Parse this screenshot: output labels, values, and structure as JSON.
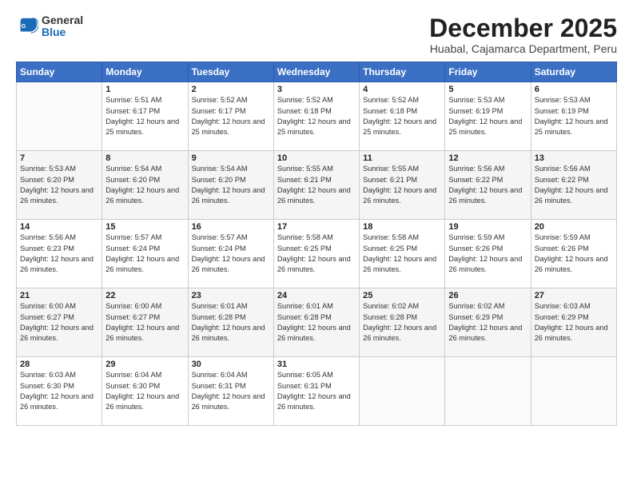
{
  "logo": {
    "general": "General",
    "blue": "Blue"
  },
  "title": "December 2025",
  "subtitle": "Huabal, Cajamarca Department, Peru",
  "days_of_week": [
    "Sunday",
    "Monday",
    "Tuesday",
    "Wednesday",
    "Thursday",
    "Friday",
    "Saturday"
  ],
  "weeks": [
    [
      {
        "day": "",
        "sunrise": "",
        "sunset": "",
        "daylight": ""
      },
      {
        "day": "1",
        "sunrise": "Sunrise: 5:51 AM",
        "sunset": "Sunset: 6:17 PM",
        "daylight": "Daylight: 12 hours and 25 minutes."
      },
      {
        "day": "2",
        "sunrise": "Sunrise: 5:52 AM",
        "sunset": "Sunset: 6:17 PM",
        "daylight": "Daylight: 12 hours and 25 minutes."
      },
      {
        "day": "3",
        "sunrise": "Sunrise: 5:52 AM",
        "sunset": "Sunset: 6:18 PM",
        "daylight": "Daylight: 12 hours and 25 minutes."
      },
      {
        "day": "4",
        "sunrise": "Sunrise: 5:52 AM",
        "sunset": "Sunset: 6:18 PM",
        "daylight": "Daylight: 12 hours and 25 minutes."
      },
      {
        "day": "5",
        "sunrise": "Sunrise: 5:53 AM",
        "sunset": "Sunset: 6:19 PM",
        "daylight": "Daylight: 12 hours and 25 minutes."
      },
      {
        "day": "6",
        "sunrise": "Sunrise: 5:53 AM",
        "sunset": "Sunset: 6:19 PM",
        "daylight": "Daylight: 12 hours and 25 minutes."
      }
    ],
    [
      {
        "day": "7",
        "sunrise": "Sunrise: 5:53 AM",
        "sunset": "Sunset: 6:20 PM",
        "daylight": "Daylight: 12 hours and 26 minutes."
      },
      {
        "day": "8",
        "sunrise": "Sunrise: 5:54 AM",
        "sunset": "Sunset: 6:20 PM",
        "daylight": "Daylight: 12 hours and 26 minutes."
      },
      {
        "day": "9",
        "sunrise": "Sunrise: 5:54 AM",
        "sunset": "Sunset: 6:20 PM",
        "daylight": "Daylight: 12 hours and 26 minutes."
      },
      {
        "day": "10",
        "sunrise": "Sunrise: 5:55 AM",
        "sunset": "Sunset: 6:21 PM",
        "daylight": "Daylight: 12 hours and 26 minutes."
      },
      {
        "day": "11",
        "sunrise": "Sunrise: 5:55 AM",
        "sunset": "Sunset: 6:21 PM",
        "daylight": "Daylight: 12 hours and 26 minutes."
      },
      {
        "day": "12",
        "sunrise": "Sunrise: 5:56 AM",
        "sunset": "Sunset: 6:22 PM",
        "daylight": "Daylight: 12 hours and 26 minutes."
      },
      {
        "day": "13",
        "sunrise": "Sunrise: 5:56 AM",
        "sunset": "Sunset: 6:22 PM",
        "daylight": "Daylight: 12 hours and 26 minutes."
      }
    ],
    [
      {
        "day": "14",
        "sunrise": "Sunrise: 5:56 AM",
        "sunset": "Sunset: 6:23 PM",
        "daylight": "Daylight: 12 hours and 26 minutes."
      },
      {
        "day": "15",
        "sunrise": "Sunrise: 5:57 AM",
        "sunset": "Sunset: 6:24 PM",
        "daylight": "Daylight: 12 hours and 26 minutes."
      },
      {
        "day": "16",
        "sunrise": "Sunrise: 5:57 AM",
        "sunset": "Sunset: 6:24 PM",
        "daylight": "Daylight: 12 hours and 26 minutes."
      },
      {
        "day": "17",
        "sunrise": "Sunrise: 5:58 AM",
        "sunset": "Sunset: 6:25 PM",
        "daylight": "Daylight: 12 hours and 26 minutes."
      },
      {
        "day": "18",
        "sunrise": "Sunrise: 5:58 AM",
        "sunset": "Sunset: 6:25 PM",
        "daylight": "Daylight: 12 hours and 26 minutes."
      },
      {
        "day": "19",
        "sunrise": "Sunrise: 5:59 AM",
        "sunset": "Sunset: 6:26 PM",
        "daylight": "Daylight: 12 hours and 26 minutes."
      },
      {
        "day": "20",
        "sunrise": "Sunrise: 5:59 AM",
        "sunset": "Sunset: 6:26 PM",
        "daylight": "Daylight: 12 hours and 26 minutes."
      }
    ],
    [
      {
        "day": "21",
        "sunrise": "Sunrise: 6:00 AM",
        "sunset": "Sunset: 6:27 PM",
        "daylight": "Daylight: 12 hours and 26 minutes."
      },
      {
        "day": "22",
        "sunrise": "Sunrise: 6:00 AM",
        "sunset": "Sunset: 6:27 PM",
        "daylight": "Daylight: 12 hours and 26 minutes."
      },
      {
        "day": "23",
        "sunrise": "Sunrise: 6:01 AM",
        "sunset": "Sunset: 6:28 PM",
        "daylight": "Daylight: 12 hours and 26 minutes."
      },
      {
        "day": "24",
        "sunrise": "Sunrise: 6:01 AM",
        "sunset": "Sunset: 6:28 PM",
        "daylight": "Daylight: 12 hours and 26 minutes."
      },
      {
        "day": "25",
        "sunrise": "Sunrise: 6:02 AM",
        "sunset": "Sunset: 6:28 PM",
        "daylight": "Daylight: 12 hours and 26 minutes."
      },
      {
        "day": "26",
        "sunrise": "Sunrise: 6:02 AM",
        "sunset": "Sunset: 6:29 PM",
        "daylight": "Daylight: 12 hours and 26 minutes."
      },
      {
        "day": "27",
        "sunrise": "Sunrise: 6:03 AM",
        "sunset": "Sunset: 6:29 PM",
        "daylight": "Daylight: 12 hours and 26 minutes."
      }
    ],
    [
      {
        "day": "28",
        "sunrise": "Sunrise: 6:03 AM",
        "sunset": "Sunset: 6:30 PM",
        "daylight": "Daylight: 12 hours and 26 minutes."
      },
      {
        "day": "29",
        "sunrise": "Sunrise: 6:04 AM",
        "sunset": "Sunset: 6:30 PM",
        "daylight": "Daylight: 12 hours and 26 minutes."
      },
      {
        "day": "30",
        "sunrise": "Sunrise: 6:04 AM",
        "sunset": "Sunset: 6:31 PM",
        "daylight": "Daylight: 12 hours and 26 minutes."
      },
      {
        "day": "31",
        "sunrise": "Sunrise: 6:05 AM",
        "sunset": "Sunset: 6:31 PM",
        "daylight": "Daylight: 12 hours and 26 minutes."
      },
      {
        "day": "",
        "sunrise": "",
        "sunset": "",
        "daylight": ""
      },
      {
        "day": "",
        "sunrise": "",
        "sunset": "",
        "daylight": ""
      },
      {
        "day": "",
        "sunrise": "",
        "sunset": "",
        "daylight": ""
      }
    ]
  ]
}
